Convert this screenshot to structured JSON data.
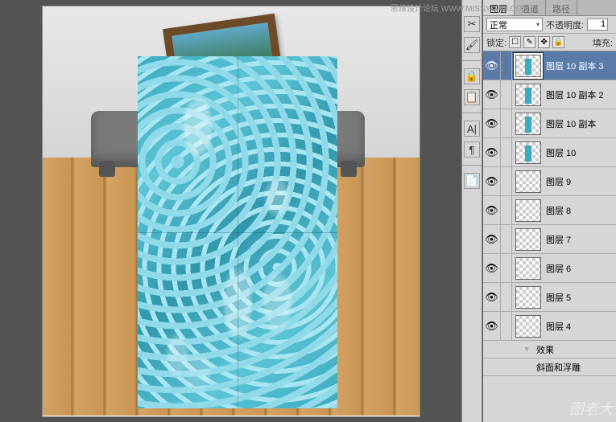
{
  "watermark_top": "思缘设计论坛  WWW.MISSYUAN.COM",
  "watermark_bottom": "图老大",
  "panel": {
    "tabs": [
      "图层",
      "通道",
      "路径"
    ],
    "blend_mode": "正常",
    "opacity_label": "不透明度:",
    "opacity_value": "1",
    "lock_label": "锁定:",
    "fill_label": "填充:",
    "lock_icons": [
      "☐",
      "✎",
      "✥",
      "🔒"
    ]
  },
  "layers": [
    {
      "name": "图层 10 副本 3",
      "visible": true,
      "selected": true,
      "thumb": "water"
    },
    {
      "name": "图层 10 副本 2",
      "visible": true,
      "selected": false,
      "thumb": "water"
    },
    {
      "name": "图层 10 副本",
      "visible": true,
      "selected": false,
      "thumb": "water"
    },
    {
      "name": "图层 10",
      "visible": true,
      "selected": false,
      "thumb": "water"
    },
    {
      "name": "图层 9",
      "visible": true,
      "selected": false,
      "thumb": "trans"
    },
    {
      "name": "图层 8",
      "visible": true,
      "selected": false,
      "thumb": "trans"
    },
    {
      "name": "图层 7",
      "visible": true,
      "selected": false,
      "thumb": "trans"
    },
    {
      "name": "图层 6",
      "visible": true,
      "selected": false,
      "thumb": "trans"
    },
    {
      "name": "图层 5",
      "visible": true,
      "selected": false,
      "thumb": "trans"
    },
    {
      "name": "图层 4",
      "visible": true,
      "selected": false,
      "thumb": "trans"
    }
  ],
  "fx": {
    "label": "效果",
    "sub": "斜面和浮雕"
  },
  "tools": [
    "✂",
    "🖌",
    "🔒",
    "📋",
    "A|",
    "¶",
    "📄"
  ]
}
